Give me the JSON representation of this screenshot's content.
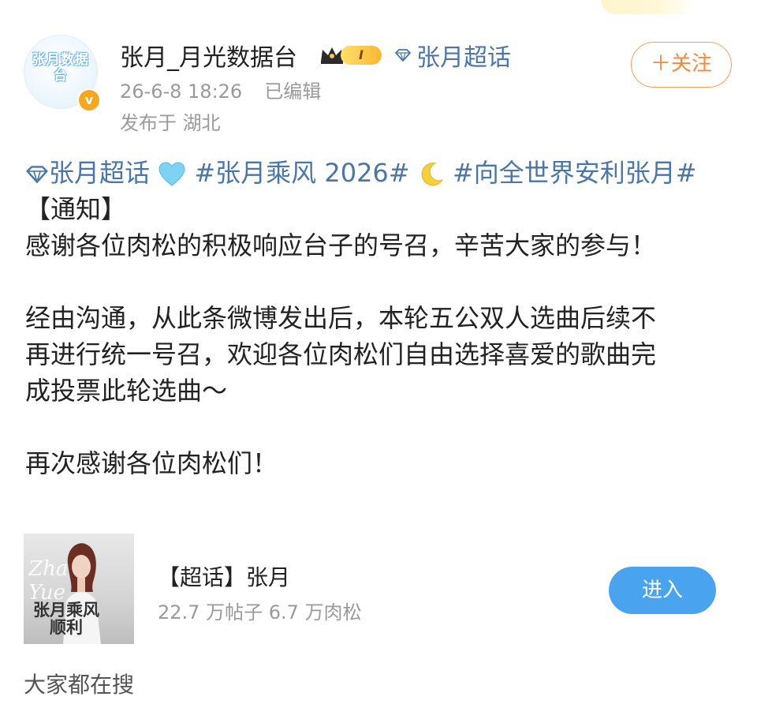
{
  "post": {
    "author": {
      "name": "张月_月光数据台",
      "avatar_text": "张月数据台",
      "level": "I",
      "verified_glyph": "v",
      "supertopic_label": "张月超话"
    },
    "meta": {
      "time": "26-6-8 18:26",
      "edited": "已编辑",
      "location": "发布于 湖北"
    },
    "follow_label": "＋关注",
    "content": {
      "topic_label": "张月超话",
      "heart_emoji": "💙",
      "hashtag_1": "#张月乘风 2026#",
      "moon_emoji": "🌙",
      "hashtag_2": "#向全世界安利张月#",
      "line_notice": "【通知】",
      "line_1": "感谢各位肉松的积极响应台子的号召，辛苦大家的参与！",
      "line_2": "经由沟通，从此条微博发出后，本轮五公双人选曲后续不",
      "line_3": "再进行统一号召，欢迎各位肉松们自由选择喜爱的歌曲完",
      "line_4": "成投票此轮选曲～",
      "line_5": "再次感谢各位肉松们！"
    }
  },
  "supertopic_card": {
    "title": "【超话】张月",
    "stats": "22.7 万帖子 6.7 万肉松",
    "enter_label": "进入",
    "thumb_script": "Zhang Yue",
    "thumb_caption": "张月乘风顺利"
  },
  "footer": {
    "label": "大家都在搜"
  },
  "colors": {
    "link": "#4a76a8",
    "follow": "#f28a3a",
    "enter_button": "#4aa3ee",
    "meta_text": "#9a9a9a",
    "verified_badge": "#f5a623"
  },
  "icons": [
    "crown-icon",
    "diamond-icon",
    "heart-emoji",
    "moon-emoji",
    "verified-icon"
  ]
}
